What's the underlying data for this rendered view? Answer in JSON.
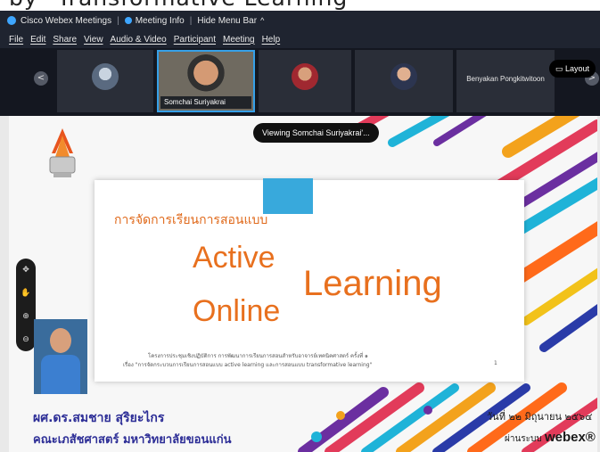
{
  "caption": {
    "text": "by \"Transformative Learning\""
  },
  "titlebar": {
    "app_name": "Cisco Webex Meetings",
    "meeting_info": "Meeting Info",
    "hide_menu": "Hide Menu Bar",
    "chevron": "^"
  },
  "menu": [
    "File",
    "Edit",
    "Share",
    "View",
    "Audio & Video",
    "Participant",
    "Meeting",
    "Help"
  ],
  "filmstrip": {
    "prev": "<",
    "next": ">",
    "layout_label": "Layout",
    "participants": [
      {
        "name": "",
        "active": false
      },
      {
        "name": "Somchai Suriyakrai",
        "active": true
      },
      {
        "name": "",
        "active": false
      },
      {
        "name": "",
        "active": false
      },
      {
        "name": "Benyakan Pongkitwitoon",
        "active": false
      }
    ]
  },
  "share": {
    "viewing_label": "Viewing Somchai Suriyakrai'...",
    "slide": {
      "thai_heading": "การจัดการเรียนการสอนแบบ",
      "word_active": "Active",
      "word_learning": "Learning",
      "word_online": "Online",
      "footer_line1": "โครงการประชุมเชิงปฏิบัติการ การพัฒนาการเรียนการสอนสำหรับอาจารย์เทคนิคศาสตร์ ครั้งที่ ๑",
      "footer_line2": "เรื่อง \"การจัดกระบวนการเรียนการสอนแบบ active learning และการสอนแบบ transformative learning\"",
      "page_number": "1"
    },
    "presenter_name": "ผศ.ดร.สมชาย สุริยะไกร",
    "faculty": "คณะเภสัชศาสตร์ มหาวิทยาลัยขอนแก่น",
    "date": "วันที่ ๒๒ มิถุนายน ๒๕๖๔",
    "via_text": "ผ่านระบบ",
    "via_brand": "webex®"
  },
  "zoom_controls": [
    "pan",
    "hand",
    "zoom-in",
    "zoom-out"
  ],
  "colors": {
    "accent_orange": "#e8701e",
    "webex_blue": "#36a0e8",
    "title_blue": "#2c2d96"
  }
}
